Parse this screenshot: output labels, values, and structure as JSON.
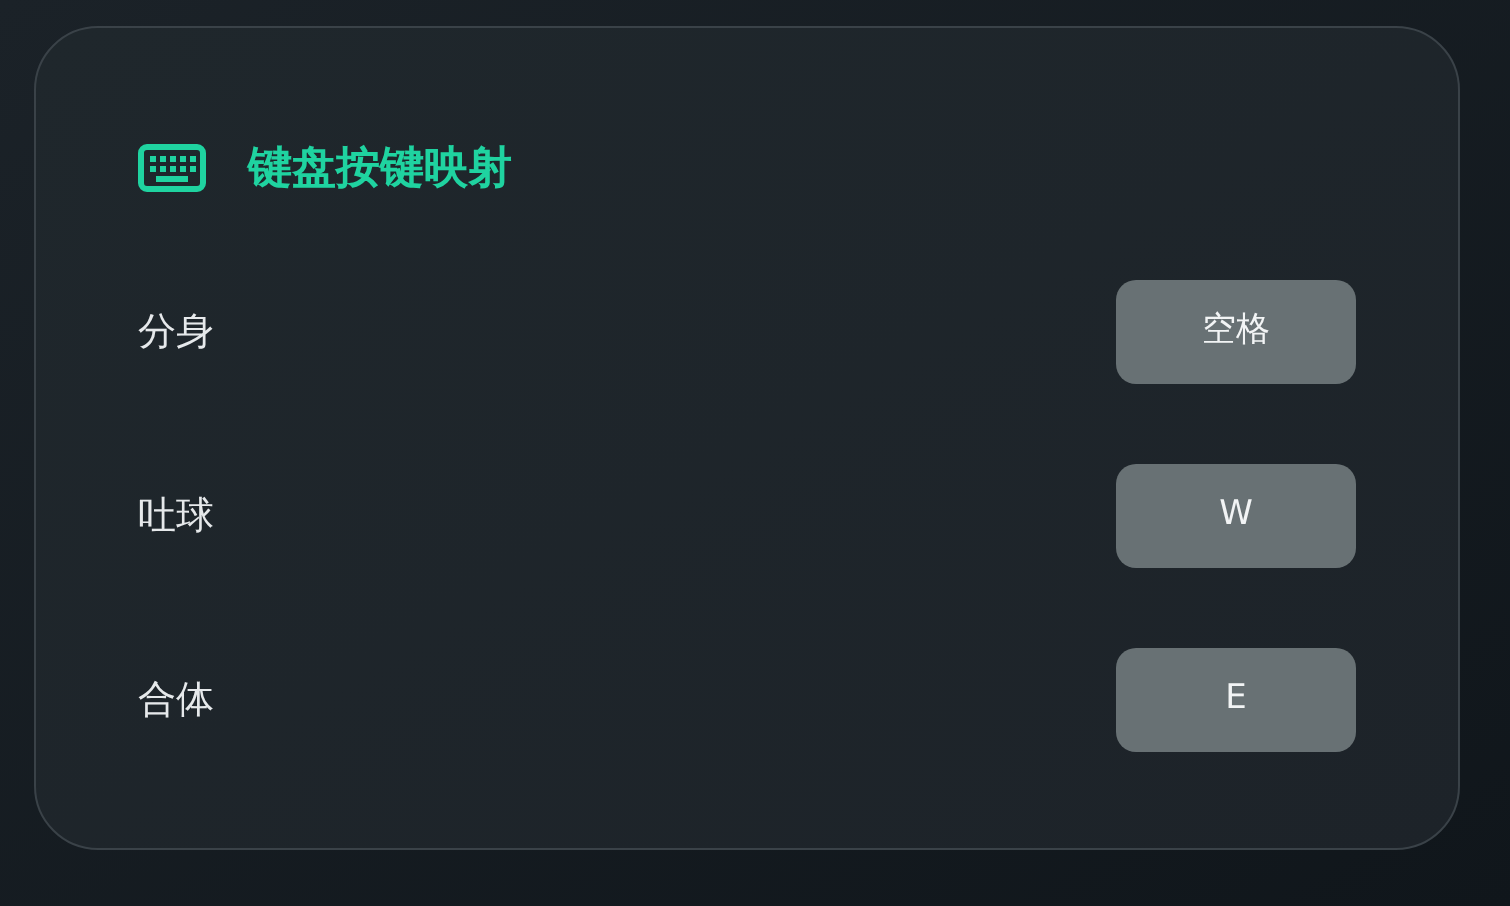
{
  "panel": {
    "title": "键盘按键映射",
    "mappings": [
      {
        "action": "分身",
        "key": "空格"
      },
      {
        "action": "吐球",
        "key": "W"
      },
      {
        "action": "合体",
        "key": "E"
      }
    ]
  }
}
